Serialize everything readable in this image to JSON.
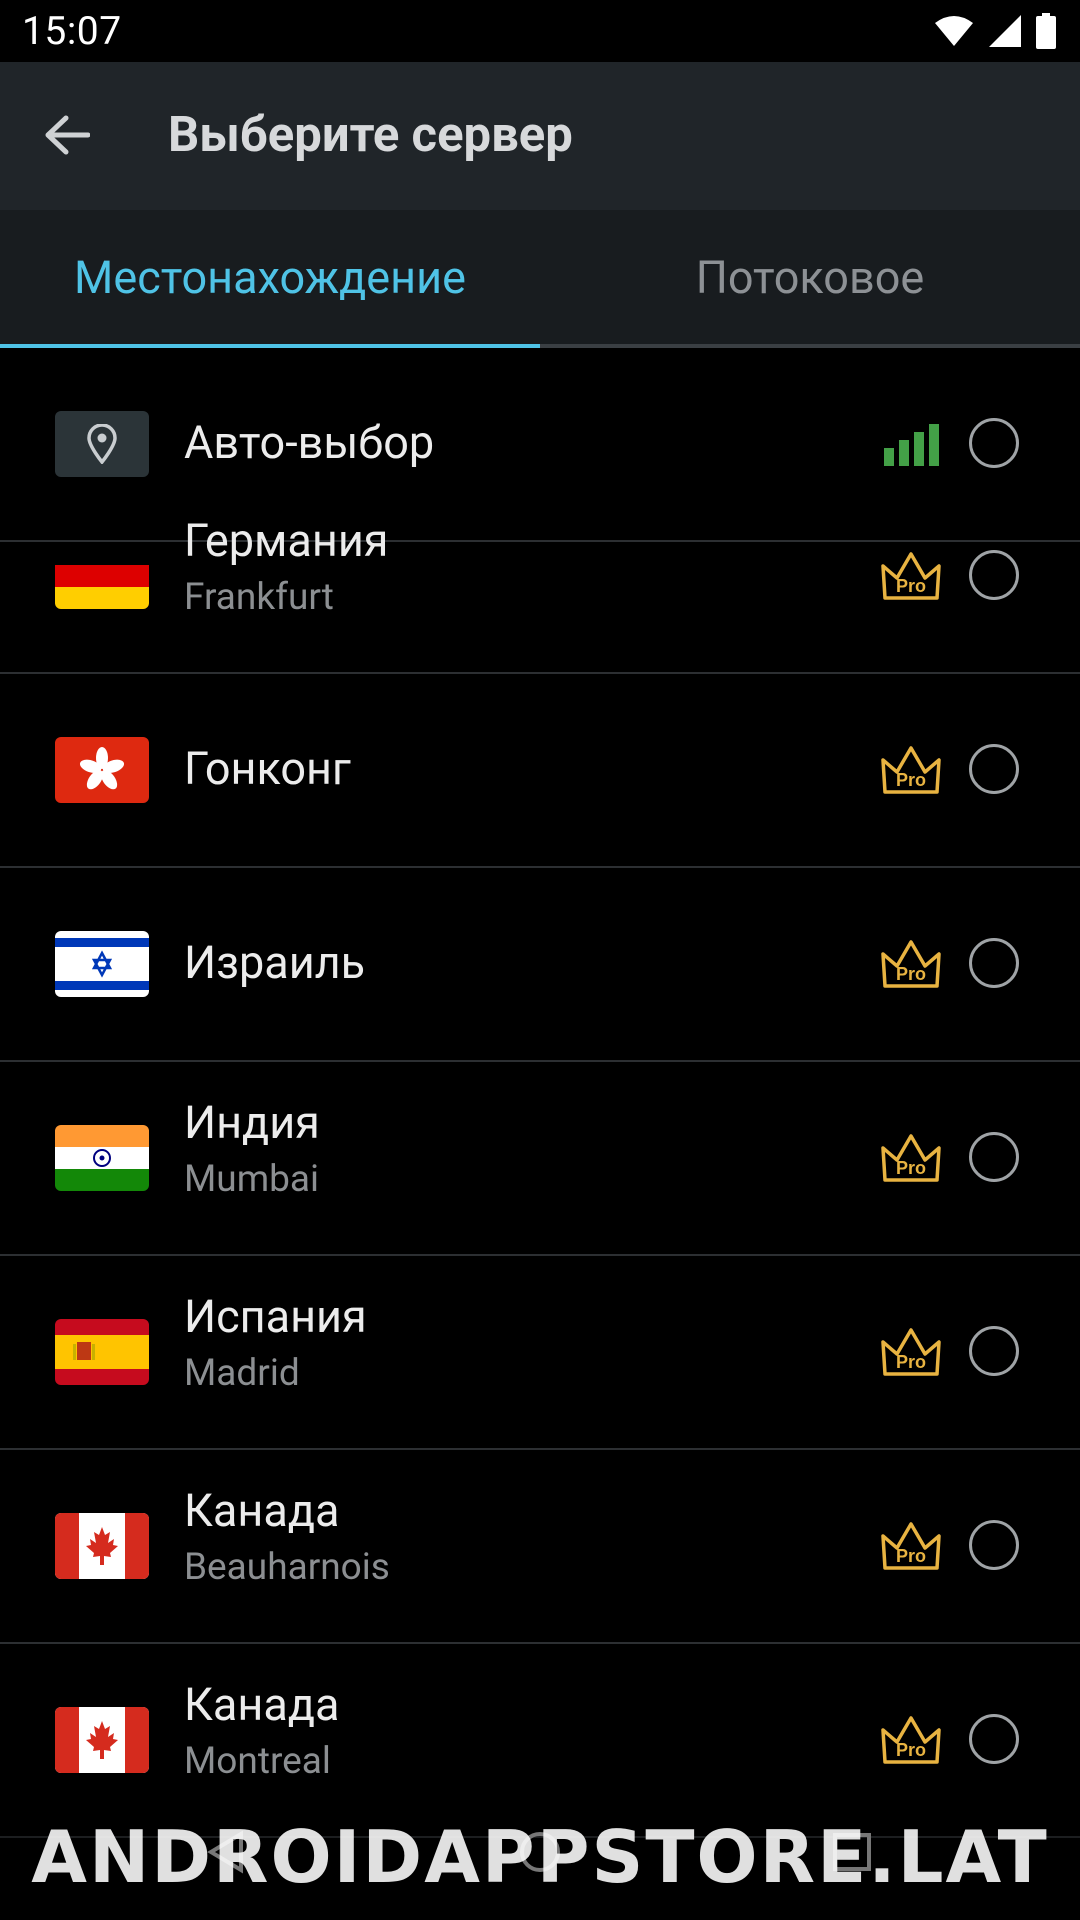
{
  "status": {
    "time": "15:07"
  },
  "appbar": {
    "title": "Выберите сервер"
  },
  "tabs": [
    {
      "label": "Местонахождение",
      "selected": true
    },
    {
      "label": "Потоковое",
      "selected": false
    }
  ],
  "auto": {
    "label": "Авто-выбор",
    "signal_color": "#43a047"
  },
  "servers": [
    {
      "country": "Германия",
      "city": "Frankfurt",
      "flag": "de",
      "pro": true
    },
    {
      "country": "Гонконг",
      "city": "",
      "flag": "hk",
      "pro": true
    },
    {
      "country": "Израиль",
      "city": "",
      "flag": "il",
      "pro": true
    },
    {
      "country": "Индия",
      "city": "Mumbai",
      "flag": "in",
      "pro": true
    },
    {
      "country": "Испания",
      "city": "Madrid",
      "flag": "es",
      "pro": true
    },
    {
      "country": "Канада",
      "city": "Beauharnois",
      "flag": "ca",
      "pro": true
    },
    {
      "country": "Канада",
      "city": "Montreal",
      "flag": "ca",
      "pro": true
    }
  ],
  "pro_badge_text": "Pro",
  "colors": {
    "accent": "#4fc3e6",
    "pro_gold": "#e8b341"
  },
  "watermark": "ANDROIDAPPSTORE.LAT"
}
